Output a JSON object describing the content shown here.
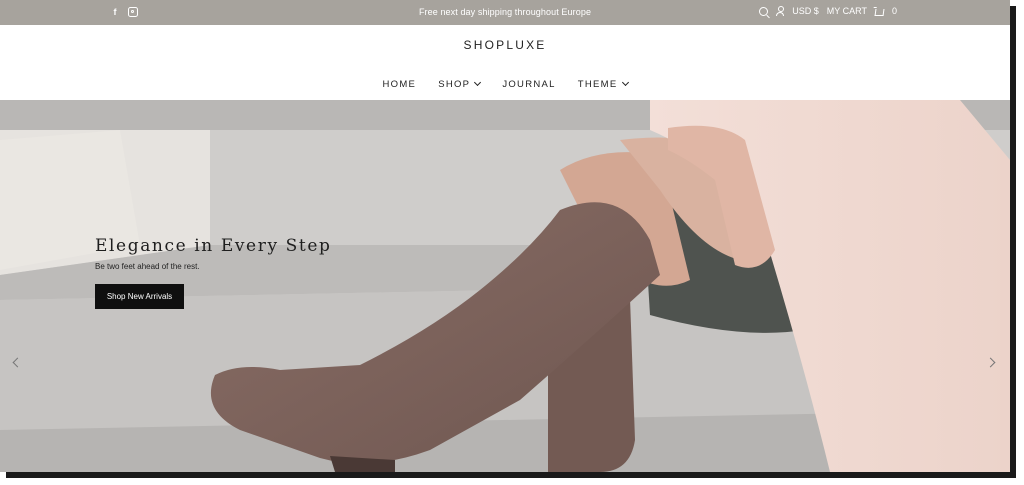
{
  "topbar": {
    "social": [
      "facebook-icon",
      "instagram-icon"
    ],
    "facebook_glyph": "f",
    "announcement": "Free next day shipping throughout Europe",
    "currency": "USD $",
    "cart_label": "MY CART",
    "cart_count": "0"
  },
  "header": {
    "logo": "SHOPLUXE",
    "nav": [
      {
        "label": "HOME",
        "has_dropdown": false
      },
      {
        "label": "SHOP",
        "has_dropdown": true
      },
      {
        "label": "JOURNAL",
        "has_dropdown": false
      },
      {
        "label": "THEME",
        "has_dropdown": true
      }
    ]
  },
  "hero": {
    "title": "Elegance in Every Step",
    "subtitle": "Be two feet ahead of the rest.",
    "cta": "Shop New Arrivals"
  },
  "colors": {
    "topbar_bg": "#a7a39d",
    "cta_bg": "#0f0f0f"
  }
}
